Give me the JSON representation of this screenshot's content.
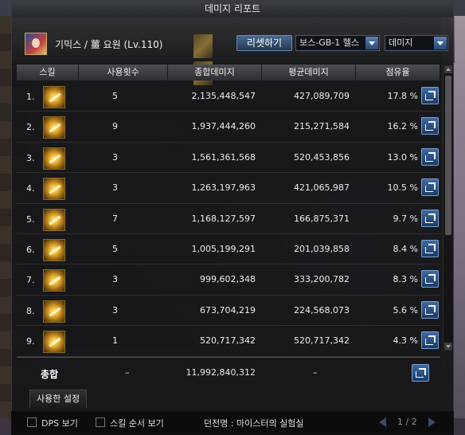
{
  "window": {
    "title": "데미지 리포트"
  },
  "header": {
    "character": "기믹스 / 薑 요원 (Lv.110)",
    "reset_label": "리셋하기",
    "boss_select": "보스-GB-1 헬스",
    "type_select": "데미지"
  },
  "table": {
    "columns": [
      "스킬",
      "사용횟수",
      "종합데미지",
      "평균데미지",
      "점유율"
    ],
    "rows": [
      {
        "rank": "1.",
        "uses": "5",
        "total": "2,135,448,547",
        "avg": "427,089,709",
        "share": "17.8 %"
      },
      {
        "rank": "2.",
        "uses": "9",
        "total": "1,937,444,260",
        "avg": "215,271,584",
        "share": "16.2 %"
      },
      {
        "rank": "3.",
        "uses": "3",
        "total": "1,561,361,568",
        "avg": "520,453,856",
        "share": "13.0 %"
      },
      {
        "rank": "4.",
        "uses": "3",
        "total": "1,263,197,963",
        "avg": "421,065,987",
        "share": "10.5 %"
      },
      {
        "rank": "5.",
        "uses": "7",
        "total": "1,168,127,597",
        "avg": "166,875,371",
        "share": "9.7 %"
      },
      {
        "rank": "6.",
        "uses": "5",
        "total": "1,005,199,291",
        "avg": "201,039,858",
        "share": "8.4 %"
      },
      {
        "rank": "7.",
        "uses": "3",
        "total": "999,602,348",
        "avg": "333,200,782",
        "share": "8.3 %"
      },
      {
        "rank": "8.",
        "uses": "3",
        "total": "673,704,219",
        "avg": "224,568,073",
        "share": "5.6 %"
      },
      {
        "rank": "9.",
        "uses": "1",
        "total": "520,717,342",
        "avg": "520,717,342",
        "share": "4.3 %"
      }
    ]
  },
  "summary": {
    "label": "총합",
    "uses": "–",
    "total": "11,992,840,312",
    "avg": "–"
  },
  "tabs": {
    "used_settings": "사용한 설정"
  },
  "footer": {
    "dps_label": "DPS 보기",
    "skill_order_label": "스킬 순서 보기",
    "dungeon": "던전명 : 마이스터의 실험실",
    "page": "1 / 2"
  }
}
